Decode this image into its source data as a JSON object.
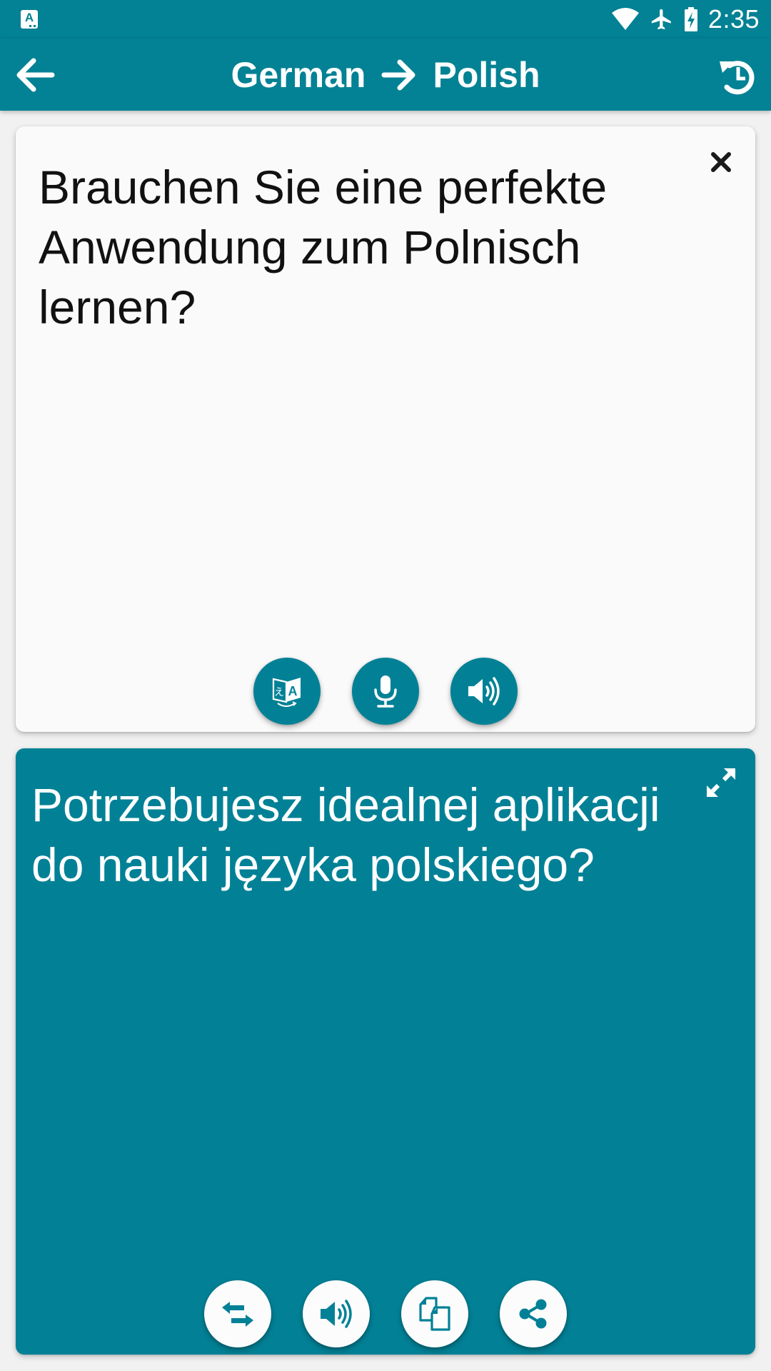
{
  "status_bar": {
    "notification_icon": "app-notification-icon",
    "icons": [
      "wifi-icon",
      "airplane-mode-icon",
      "battery-charging-icon"
    ],
    "time": "2:35"
  },
  "app_bar": {
    "back_icon": "arrow-back-icon",
    "source_language": "German",
    "direction_icon": "arrow-right-icon",
    "target_language": "Polish",
    "history_icon": "history-icon"
  },
  "source_card": {
    "text": "Brauchen Sie eine perfekte Anwendung zum Polnisch lernen?",
    "clear_icon": "close-icon",
    "buttons": [
      {
        "name": "translate-button",
        "icon": "translate-icon"
      },
      {
        "name": "microphone-button",
        "icon": "microphone-icon"
      },
      {
        "name": "speak-source-button",
        "icon": "volume-icon"
      }
    ]
  },
  "target_card": {
    "text": "Potrzebujesz idealnej aplikacji do nauki języka polskiego?",
    "expand_icon": "fullscreen-icon",
    "buttons": [
      {
        "name": "swap-languages-button",
        "icon": "swap-icon"
      },
      {
        "name": "speak-target-button",
        "icon": "volume-icon"
      },
      {
        "name": "copy-button",
        "icon": "copy-icon"
      },
      {
        "name": "share-button",
        "icon": "share-icon"
      }
    ]
  },
  "colors": {
    "primary": "#028294",
    "card_target": "#028196",
    "background": "#f1f1f1",
    "card_source": "#fafafa"
  }
}
